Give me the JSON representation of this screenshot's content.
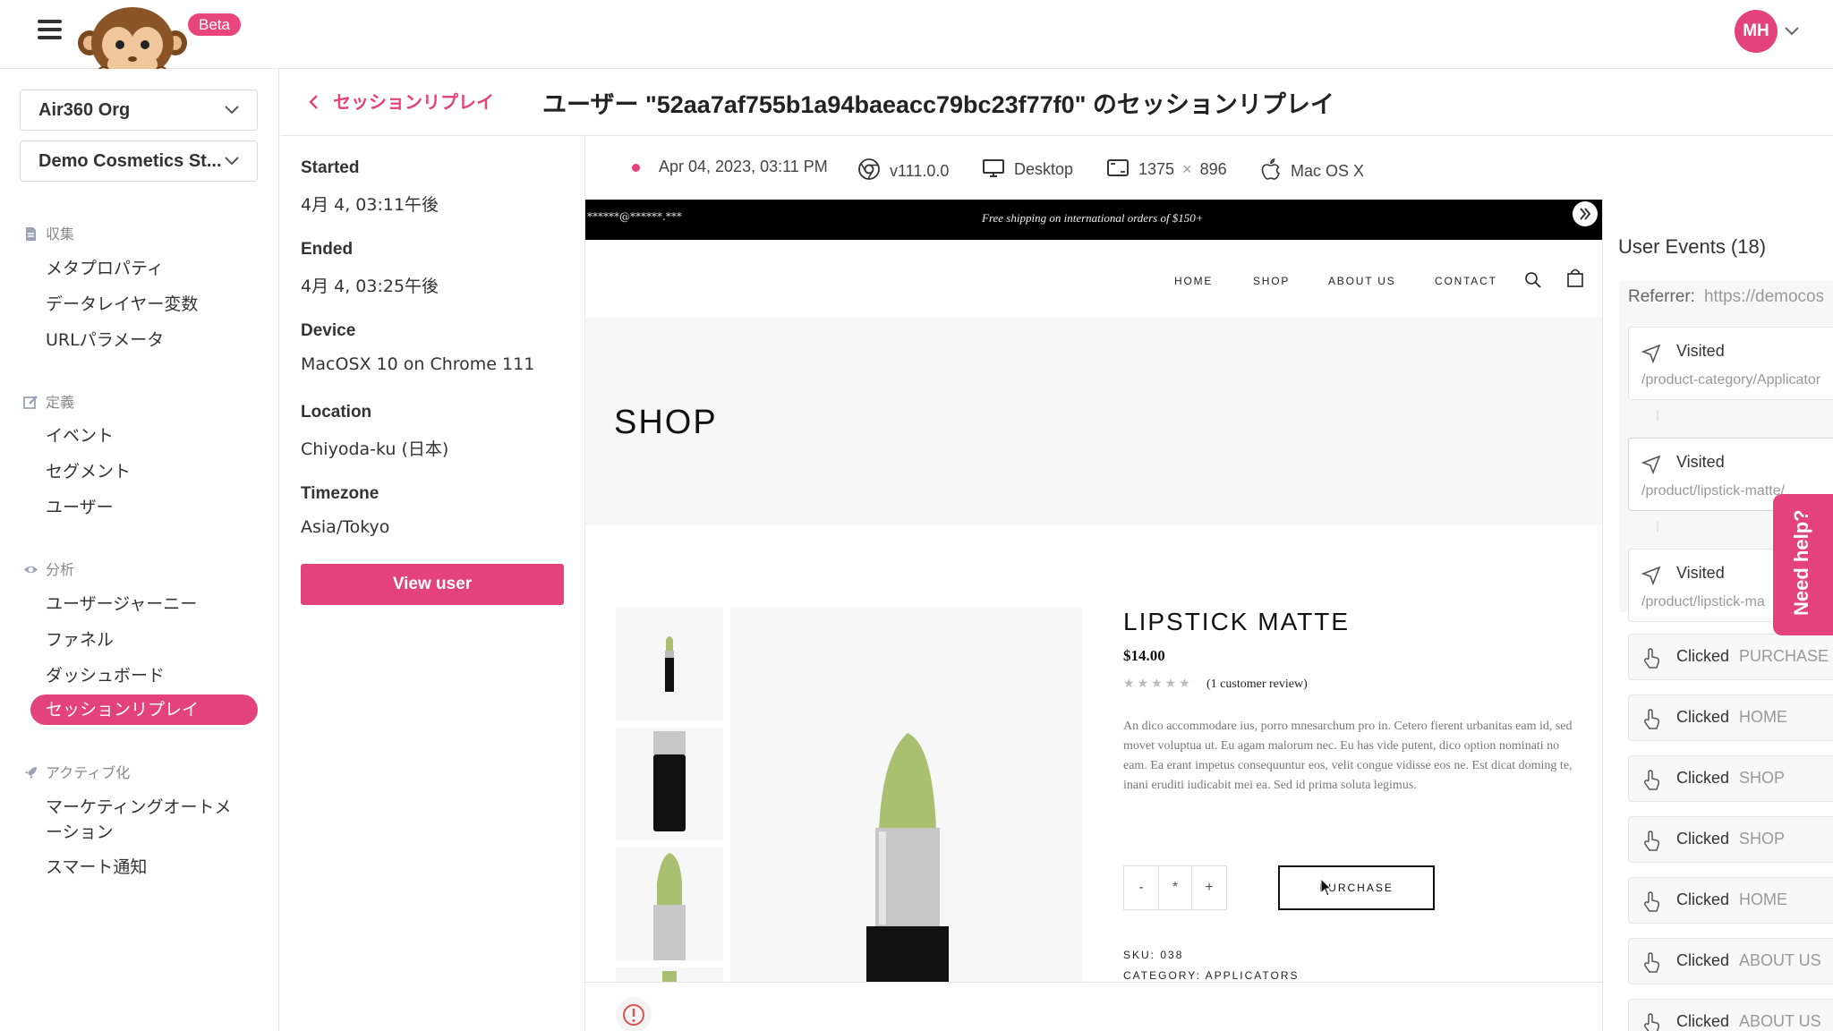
{
  "app": {
    "beta_label": "Beta",
    "user_initials": "MH",
    "accent": "#e3427a"
  },
  "sidebar": {
    "org_select": "Air360 Org",
    "site_select": "Demo Cosmetics St...",
    "sections": [
      {
        "title": "収集",
        "icon": "document-icon",
        "items": [
          "メタプロパティ",
          "データレイヤー変数",
          "URLパラメータ"
        ]
      },
      {
        "title": "定義",
        "icon": "edit-icon",
        "items": [
          "イベント",
          "セグメント",
          "ユーザー"
        ]
      },
      {
        "title": "分析",
        "icon": "eye-icon",
        "items": [
          "ユーザージャーニー",
          "ファネル",
          "ダッシュボード",
          "セッションリプレイ"
        ]
      },
      {
        "title": "アクティブ化",
        "icon": "rocket-icon",
        "items": [
          "マーケティングオートメ",
          "ーション",
          "スマート通知"
        ]
      }
    ],
    "active_item": "セッションリプレイ"
  },
  "header": {
    "back_label": "セッションリプレイ",
    "title": "ユーザー \"52aa7af755b1a94baeacc79bc23f77f0\" のセッションリプレイ"
  },
  "session": {
    "started_label": "Started",
    "started_value": "4月 4, 03:11午後",
    "ended_label": "Ended",
    "ended_value": "4月 4, 03:25午後",
    "device_label": "Device",
    "device_value": "MacOSX 10 on Chrome 111",
    "location_label": "Location",
    "location_value": "Chiyoda-ku (日本)",
    "timezone_label": "Timezone",
    "timezone_value": "Asia/Tokyo",
    "view_user_label": "View user"
  },
  "meta": {
    "date": "Apr 04, 2023, 03:11 PM",
    "browser_version": "v111.0.0",
    "device_type": "Desktop",
    "screen_w": "1375",
    "screen_x": "×",
    "screen_h": "896",
    "os": "Mac OS X"
  },
  "replay": {
    "masked_text": "******@******.***",
    "promo": "Free shipping on international orders of $150+",
    "nav": [
      "HOME",
      "SHOP",
      "ABOUT US",
      "CONTACT"
    ],
    "page_title": "SHOP",
    "product": {
      "title": "LIPSTICK MATTE",
      "price": "$14.00",
      "stars": "★★★★★",
      "review": "(1 customer review)",
      "description": "An dico accommodare ius, porro mnesarchum pro in. Cetero fierent urbanitas eam id, sed movet voluptua ut. Eu agam malorum nec. Eu has vide putent, dico option nominati no eam. Ea erant impetus consequuntur eos, velit congue vidisse eos ne. Est dicat doming te, inani eruditi iudicabit mei ea. Sed id prima soluta legimus.",
      "qty_minus": "-",
      "qty_value": "*",
      "qty_plus": "+",
      "purchase": "PURCHASE",
      "sku": "SKU: 038",
      "category": "CATEGORY: APPLICATORS"
    }
  },
  "events": {
    "title": "User Events (18)",
    "referrer_label": "Referrer:",
    "referrer_value": "https://democos",
    "visited": [
      {
        "kind": "Visited",
        "path": "/product-category/Applicator"
      },
      {
        "kind": "Visited",
        "path": "/product/lipstick-matte/"
      },
      {
        "kind": "Visited",
        "path": "/product/lipstick-ma"
      }
    ],
    "clicked": [
      {
        "kind": "Clicked",
        "target": "PURCHASE"
      },
      {
        "kind": "Clicked",
        "target": "HOME"
      },
      {
        "kind": "Clicked",
        "target": "SHOP"
      },
      {
        "kind": "Clicked",
        "target": "SHOP"
      },
      {
        "kind": "Clicked",
        "target": "HOME"
      },
      {
        "kind": "Clicked",
        "target": "ABOUT US"
      },
      {
        "kind": "Clicked",
        "target": "ABOUT US"
      }
    ]
  },
  "help": {
    "label": "Need help?"
  }
}
